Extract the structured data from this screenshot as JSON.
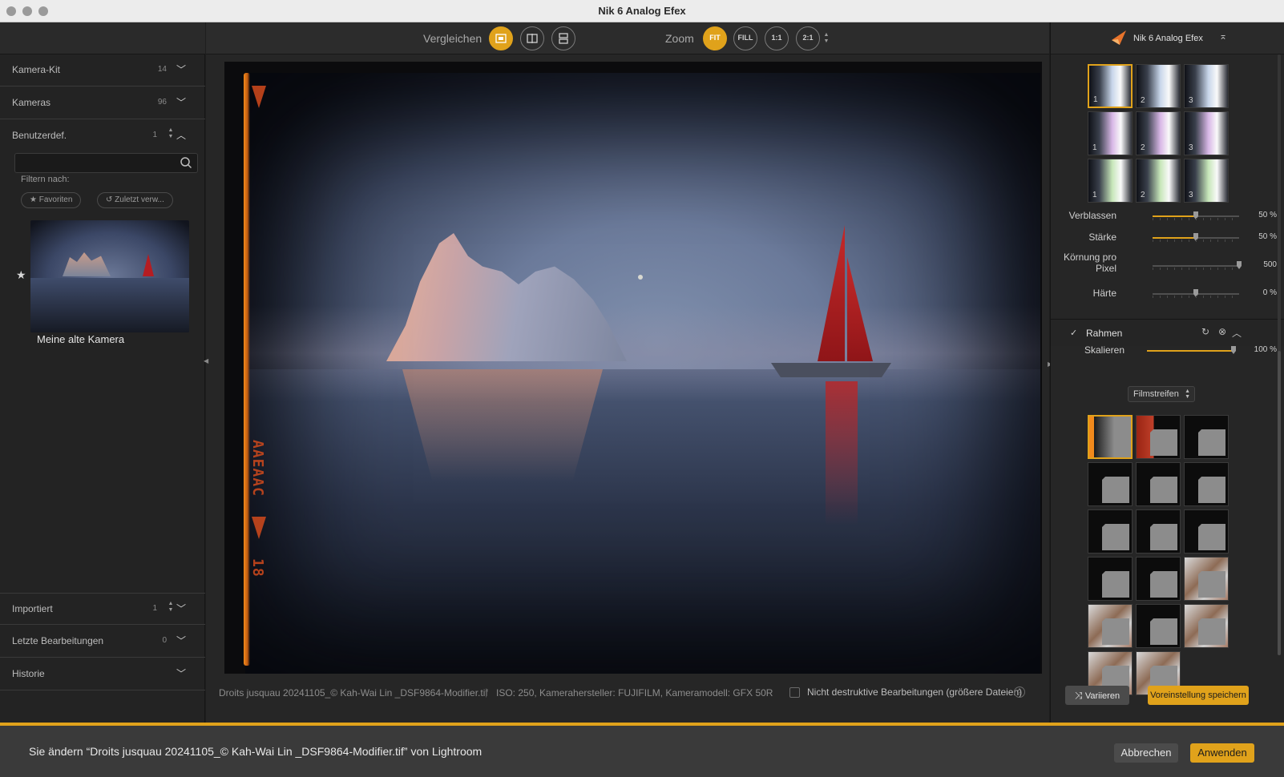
{
  "window": {
    "title": "Nik 6 Analog Efex"
  },
  "left_panel": {
    "sections": [
      {
        "label": "Kamera-Kit",
        "count": "14"
      },
      {
        "label": "Kameras",
        "count": "96"
      },
      {
        "label": "Benutzerdef.",
        "count": "1"
      }
    ],
    "search_placeholder": "",
    "filter_label": "Filtern nach:",
    "chips": [
      "★ Favoriten",
      "↺ Zuletzt verw..."
    ],
    "preset": {
      "name": "Meine alte Kamera",
      "starred": true
    },
    "bottom_sections": [
      {
        "label": "Importiert",
        "count": "1"
      },
      {
        "label": "Letzte Bearbeitungen",
        "count": "0"
      },
      {
        "label": "Historie",
        "count": ""
      }
    ]
  },
  "toolbar": {
    "compare_label": "Vergleichen",
    "zoom_label": "Zoom",
    "zoom_buttons": [
      "FIT",
      "FILL",
      "1:1",
      "2:1"
    ],
    "active_zoom": "FIT"
  },
  "image_info": {
    "file_name": "Droits jusquau 20241105_© Kah-Wai Lin _DSF9864-Modifier.tif",
    "separator": "|",
    "meta": "ISO: 250, Kamerahersteller: FUJIFILM, Kameramodell: GFX 50R",
    "nondestructive_label": "Nicht destruktive Bearbeitungen (größere Dateien)",
    "nondestructive_checked": false,
    "help": "?",
    "film_code": "AAEAAC",
    "film_number": "18"
  },
  "right_panel": {
    "header_title": "Nik 6 Analog Efex",
    "light_swatches": [
      {
        "num": "1",
        "selected": true,
        "tone": "#c8d6ea"
      },
      {
        "num": "2",
        "selected": false,
        "tone": "#c8d6ea"
      },
      {
        "num": "3",
        "selected": false,
        "tone": "#c8d6ea"
      },
      {
        "num": "1",
        "selected": false,
        "tone": "#d8b7e6"
      },
      {
        "num": "2",
        "selected": false,
        "tone": "#d8b7e6"
      },
      {
        "num": "3",
        "selected": false,
        "tone": "#d8b7e6"
      },
      {
        "num": "1",
        "selected": false,
        "tone": "#c7e6b9"
      },
      {
        "num": "2",
        "selected": false,
        "tone": "#c7e6b9"
      },
      {
        "num": "3",
        "selected": false,
        "tone": "#c7e6b9"
      }
    ],
    "sliders": [
      {
        "label": "Verblassen",
        "value": "50 %",
        "level": 0.5,
        "fill": true
      },
      {
        "label": "Stärke",
        "value": "50 %",
        "level": 0.5,
        "fill": true
      },
      {
        "label": "Körnung pro Pixel",
        "label_line1": "Körnung pro",
        "label_line2": "Pixel",
        "value": "500",
        "level": 1.0,
        "fill": false
      },
      {
        "label": "Härte",
        "value": "0 %",
        "level": 0.5,
        "fill": false
      }
    ],
    "frame_section": {
      "title": "Rahmen",
      "enabled": true,
      "scale_label": "Skalieren",
      "scale_value": "100 %",
      "scale_level": 1.0,
      "dropdown_value": "Filmstreifen"
    },
    "frame_thumbs": [
      {
        "style": "film",
        "selected": true
      },
      {
        "style": "red",
        "selected": false
      },
      {
        "style": "plain",
        "selected": false
      },
      {
        "style": "plain",
        "selected": false
      },
      {
        "style": "plain",
        "selected": false
      },
      {
        "style": "plain",
        "selected": false
      },
      {
        "style": "plain",
        "selected": false
      },
      {
        "style": "plain",
        "selected": false
      },
      {
        "style": "plain",
        "selected": false
      },
      {
        "style": "plain",
        "selected": false
      },
      {
        "style": "plain",
        "selected": false
      },
      {
        "style": "grunge",
        "selected": false
      },
      {
        "style": "grunge",
        "selected": false
      },
      {
        "style": "plain",
        "selected": false
      },
      {
        "style": "grunge",
        "selected": false
      },
      {
        "style": "grunge",
        "selected": false
      },
      {
        "style": "grunge",
        "selected": false
      }
    ],
    "vary_button": "Variieren",
    "save_preset_button": "Voreinstellung speichern"
  },
  "bottom_bar": {
    "message": "Sie ändern “Droits jusquau 20241105_© Kah-Wai Lin _DSF9864-Modifier.tif” von Lightroom",
    "cancel_button": "Abbrechen",
    "apply_button": "Anwenden"
  },
  "colors": {
    "accent": "#e0a21b",
    "panel": "#232323",
    "text": "#cfcfcf",
    "sail": "#b51d22"
  }
}
